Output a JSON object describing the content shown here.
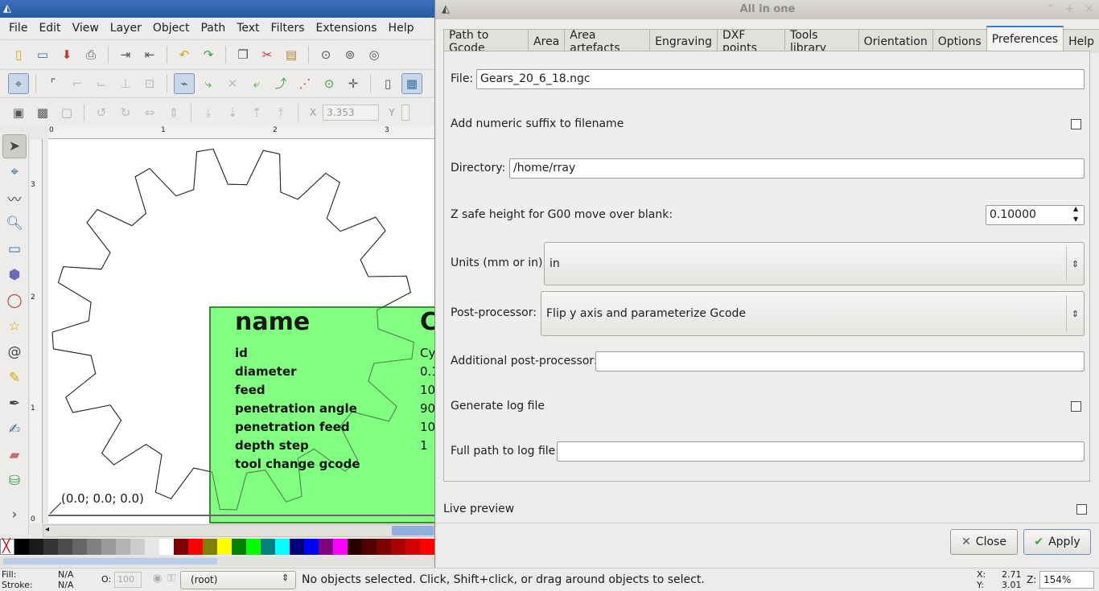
{
  "menu": [
    "File",
    "Edit",
    "View",
    "Layer",
    "Object",
    "Path",
    "Text",
    "Filters",
    "Extensions",
    "Help"
  ],
  "coords": {
    "x_label": "X",
    "x_value": "3.353",
    "y_label": "Y"
  },
  "ruler": {
    "h": [
      "0",
      "1",
      "2",
      "3"
    ],
    "v": [
      "3",
      "2",
      "1",
      "0"
    ]
  },
  "canvas": {
    "origin_label": "(0.0; 0.0; 0.0)",
    "tool_title": "name",
    "tool_title_partial": "C",
    "tool_rows": [
      {
        "label": "id",
        "value": "Cy"
      },
      {
        "label": "diameter",
        "value": "0.1"
      },
      {
        "label": "feed",
        "value": "10"
      },
      {
        "label": "penetration angle",
        "value": "90"
      },
      {
        "label": "penetration feed",
        "value": "10"
      },
      {
        "label": "depth step",
        "value": "1"
      },
      {
        "label": "tool change gcode",
        "value": ""
      }
    ]
  },
  "dialog": {
    "title": "All in one",
    "tabs": [
      "Path to Gcode",
      "Area",
      "Area artefacts",
      "Engraving",
      "DXF points",
      "Tools library",
      "Orientation",
      "Options",
      "Preferences",
      "Help"
    ],
    "selected_tab": "Preferences",
    "file_label": "File:",
    "file_value": "Gears_20_6_18.ngc",
    "suffix_label": "Add numeric suffix to filename",
    "dir_label": "Directory:",
    "dir_value": "/home/rray",
    "zsafe_label": "Z safe height for G00 move over blank:",
    "zsafe_value": "0.10000",
    "units_label": "Units (mm or in):",
    "units_value": "in",
    "post_label": "Post-processor:",
    "post_value": "Flip y axis and parameterize Gcode",
    "addpost_label": "Additional post-processor:",
    "addpost_value": "",
    "log_label": "Generate log file",
    "logpath_label": "Full path to log file:",
    "logpath_value": "",
    "live_label": "Live preview",
    "close_label": "Close",
    "apply_label": "Apply"
  },
  "status": {
    "fill_label": "Fill:",
    "fill_value": "N/A",
    "stroke_label": "Stroke:",
    "stroke_value": "N/A",
    "opacity_label": "O:",
    "opacity_value": "100",
    "layer": "(root)",
    "message": "No objects selected. Click, Shift+click, or drag around objects to select.",
    "x_label": "X:",
    "x_value": "2.71",
    "y_label": "Y:",
    "y_value": "3.01",
    "zoom_label": "Z:",
    "zoom_value": "154%"
  },
  "palette": [
    "#000000",
    "#1a1a1a",
    "#333333",
    "#4d4d4d",
    "#666666",
    "#808080",
    "#999999",
    "#b3b3b3",
    "#cccccc",
    "#e6e6e6",
    "#ffffff",
    "#800000",
    "#ff0000",
    "#808000",
    "#ffff00",
    "#008000",
    "#00ff00",
    "#008080",
    "#00ffff",
    "#000080",
    "#0000ff",
    "#800080",
    "#ff00ff",
    "#2b0000",
    "#550000",
    "#800000",
    "#aa0000",
    "#d40000",
    "#ff0000"
  ]
}
